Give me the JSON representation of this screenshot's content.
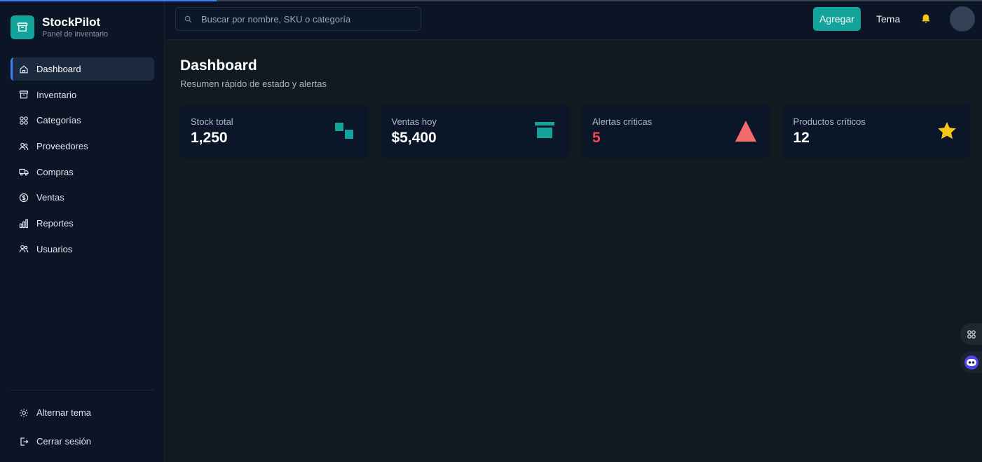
{
  "brand": {
    "title": "StockPilot",
    "subtitle": "Panel de inventario",
    "icon": "archive-box-icon"
  },
  "search": {
    "placeholder": "Buscar por nombre, SKU o categoría",
    "icon": "search-icon"
  },
  "header": {
    "add_label": "Agregar",
    "theme_label": "Tema",
    "bell_icon": "bell-icon"
  },
  "sidebar": {
    "items": [
      {
        "label": "Dashboard",
        "icon": "home-icon",
        "active": true
      },
      {
        "label": "Inventario",
        "icon": "archive-icon"
      },
      {
        "label": "Categorías",
        "icon": "grid-icon"
      },
      {
        "label": "Proveedores",
        "icon": "users-icon"
      },
      {
        "label": "Compras",
        "icon": "truck-icon"
      },
      {
        "label": "Ventas",
        "icon": "dollar-icon"
      },
      {
        "label": "Reportes",
        "icon": "bar-chart-icon"
      },
      {
        "label": "Usuarios",
        "icon": "users-icon"
      }
    ],
    "bottom": [
      {
        "label": "Alternar tema",
        "icon": "sun-icon"
      },
      {
        "label": "Cerrar sesión",
        "icon": "logout-icon"
      }
    ]
  },
  "main": {
    "title": "Dashboard",
    "subtitle": "Resumen rápido de estado y alertas",
    "cards": [
      {
        "label": "Stock total",
        "value": "1,250",
        "icon": "blocks-icon"
      },
      {
        "label": "Ventas hoy",
        "value": "$5,400",
        "icon": "archive-solid-icon"
      },
      {
        "label": "Alertas críticas",
        "value": "5",
        "icon": "warning-triangle-icon"
      },
      {
        "label": "Productos críticos",
        "value": "12",
        "icon": "star-icon"
      }
    ]
  },
  "colors": {
    "accent": "#14a39a",
    "active_indicator": "#3b82f6",
    "alert": "#f0484e",
    "triangle": "#f36b6b",
    "star": "#f5c518",
    "bell": "#f5c518"
  }
}
